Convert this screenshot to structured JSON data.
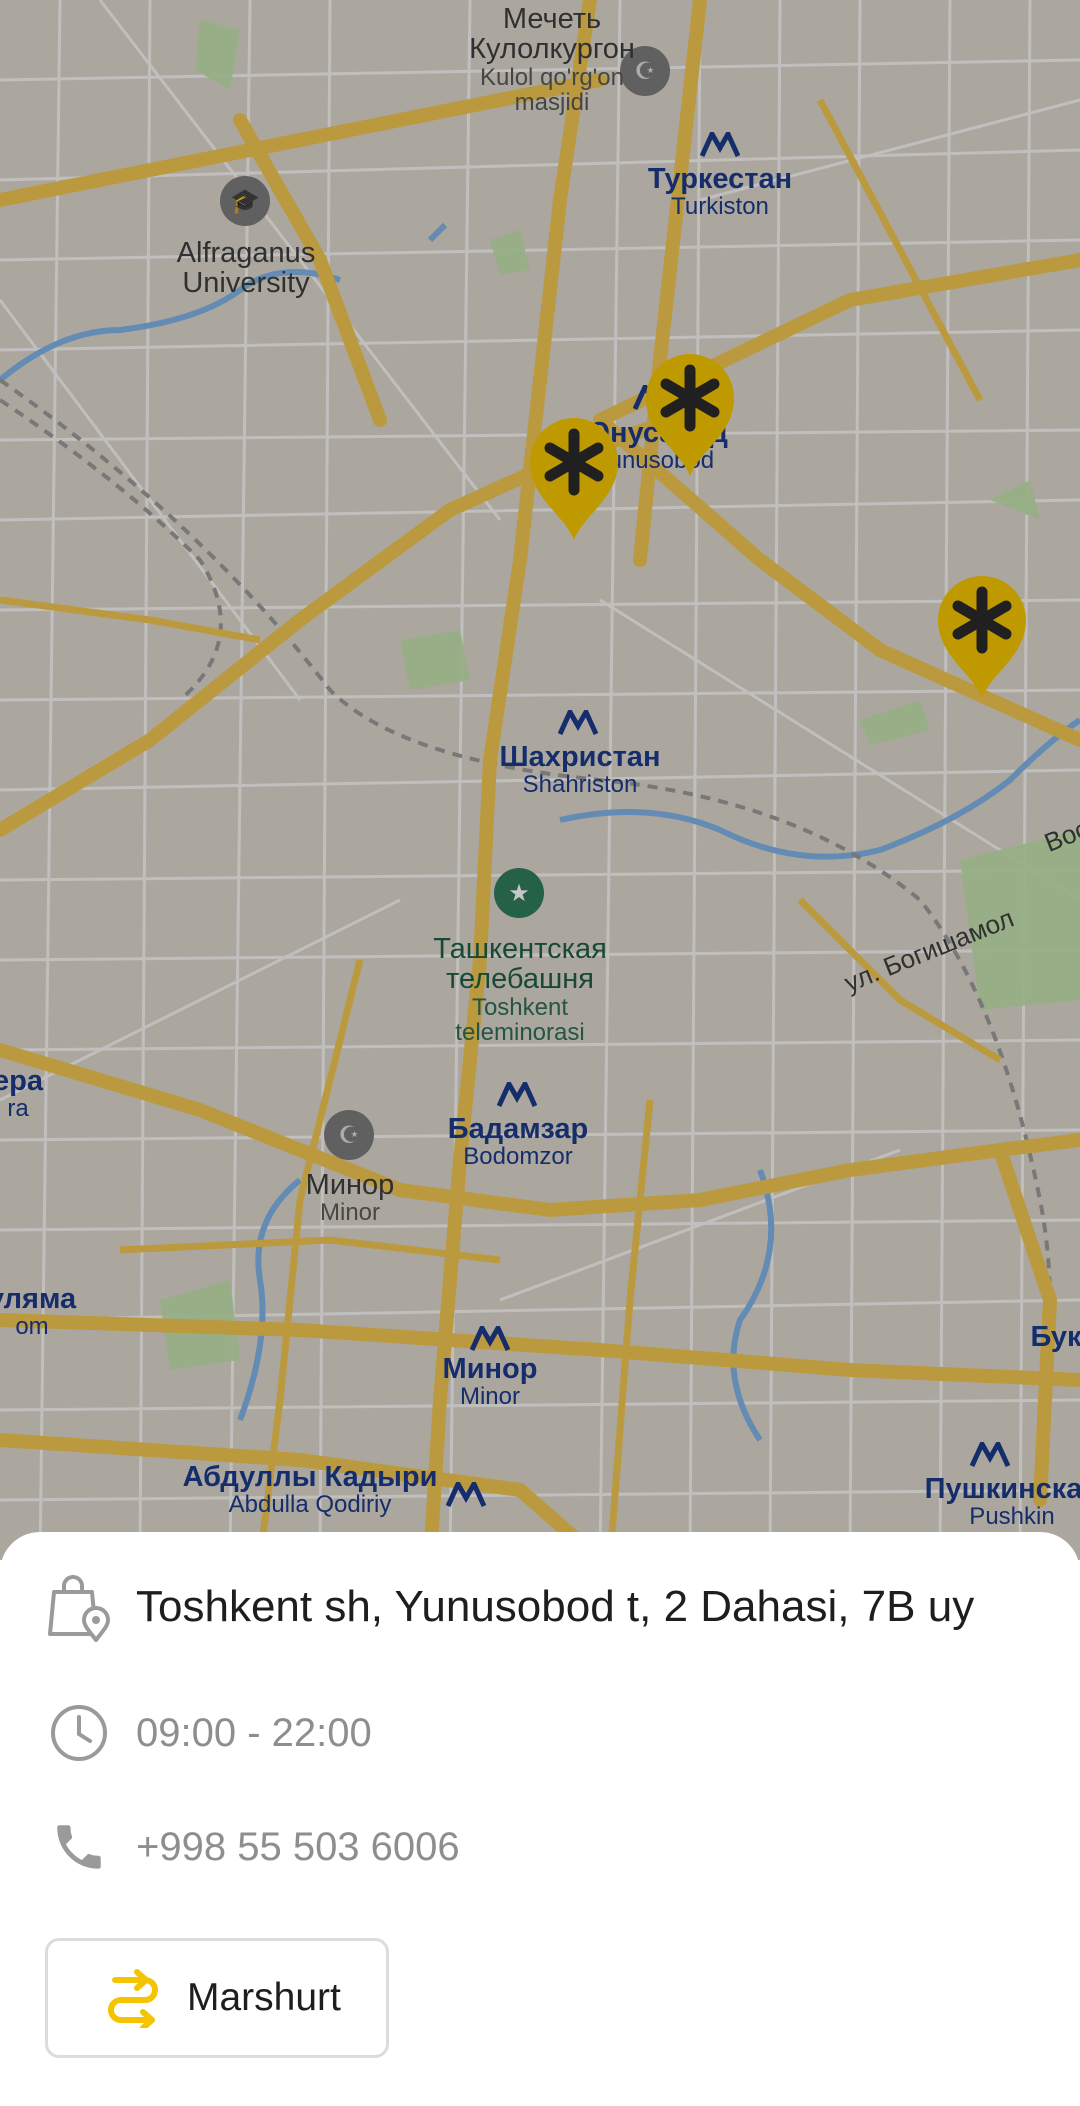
{
  "map": {
    "labels": {
      "mosque_ru_1": "Мечеть",
      "mosque_ru_2": "Кулолкургон",
      "mosque_lat_1": "Kulol qo'rg'on",
      "mosque_lat_2": "masjidi",
      "turkiston_ru": "Туркестан",
      "turkiston_lat": "Turkiston",
      "alfraganus_1": "Alfraganus",
      "alfraganus_2": "University",
      "yunusobod_ru": "Юнусабад",
      "yunusobod_lat": "Yunusobod",
      "shahriston_ru": "Шахристан",
      "shahriston_lat": "Shahriston",
      "tv_ru_1": "Ташкентская",
      "tv_ru_2": "телебашня",
      "tv_lat_1": "Toshkent",
      "tv_lat_2": "teleminorasi",
      "street_bogishamol": "ул. Богишамол",
      "street_partial": "Вос",
      "bodomzor_ru": "Бадамзар",
      "bodomzor_lat": "Bodomzor",
      "minor_poi_ru": "Минор",
      "minor_poi_lat": "Minor",
      "minor_metro_ru": "Минор",
      "minor_metro_lat": "Minor",
      "abdulla_ru": "Абдуллы Кадыри",
      "abdulla_lat": "Abdulla Qodiriy",
      "pushkin_ru": "Пушкинская",
      "pushkin_lat": "Pushkin",
      "left_edge_1": "ера",
      "left_edge_2": "ra",
      "left_edge_3": "уляма",
      "left_edge_4": "om",
      "right_edge_1": "Бук"
    },
    "markers": [
      {
        "name": "store-marker-1"
      },
      {
        "name": "store-marker-2"
      },
      {
        "name": "store-marker-3"
      }
    ]
  },
  "details": {
    "address": "Toshkent sh, Yunusobod t, 2 Dahasi, 7B uy",
    "hours": "09:00 - 22:00",
    "phone": "+998 55 503 6006",
    "route_label": "Marshurt"
  },
  "colors": {
    "accent": "#F5C400",
    "marker_fill": "#F5C400",
    "road_major": "#f0c450",
    "road_minor": "#ffffff",
    "water": "#7fb3e6",
    "park": "#bfe0a8",
    "metro": "#1d3a8a"
  },
  "icons": {
    "address": "shopping-bag-location-icon",
    "hours": "clock-icon",
    "phone": "phone-icon",
    "route": "route-icon"
  }
}
